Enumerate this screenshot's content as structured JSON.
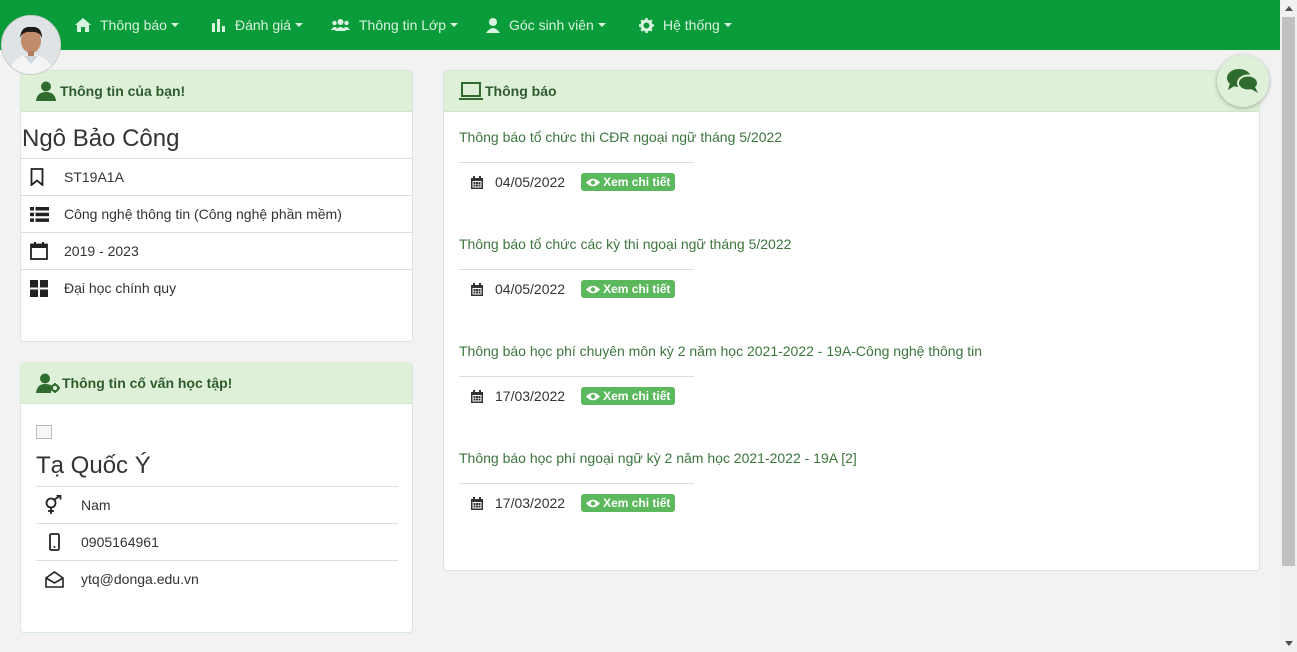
{
  "nav": {
    "items": [
      {
        "label": "Thông báo",
        "icon": "home-icon"
      },
      {
        "label": "Đánh giá",
        "icon": "bar-chart-icon"
      },
      {
        "label": "Thông tin Lớp",
        "icon": "users-icon"
      },
      {
        "label": "Góc sinh viên",
        "icon": "user-icon"
      },
      {
        "label": "Hệ thống",
        "icon": "gear-icon"
      }
    ]
  },
  "student": {
    "heading": "Thông tin của bạn!",
    "name": "Ngô Bảo Công",
    "class_code": "ST19A1A",
    "major": "Công nghệ thông tin (Công nghệ phần mềm)",
    "years": "2019 - 2023",
    "program": "Đại học chính quy"
  },
  "advisor": {
    "heading": "Thông tin cố vấn học tập!",
    "name": "Tạ Quốc Ý",
    "gender": "Nam",
    "phone": "0905164961",
    "email": "ytq@donga.edu.vn"
  },
  "notices": {
    "heading": "Thông báo",
    "detail_label": "Xem chi tiết",
    "items": [
      {
        "title": "Thông báo tổ chức thi CĐR ngoại ngữ tháng 5/2022",
        "date": "04/05/2022"
      },
      {
        "title": "Thông báo tổ chức các kỳ thi ngoại ngữ tháng 5/2022",
        "date": "04/05/2022"
      },
      {
        "title": "Thông báo học phí chuyên môn kỳ 2 năm học 2021-2022 - 19A-Công nghệ thông tin",
        "date": "17/03/2022"
      },
      {
        "title": "Thông báo học phí ngoại ngữ kỳ 2 năm học 2021-2022 - 19A [2]",
        "date": "17/03/2022"
      }
    ]
  },
  "colors": {
    "navbar": "#0a9b3a",
    "panel_header": "#dff0d8",
    "accent_text": "#3c763d",
    "badge": "#5cb85c"
  }
}
